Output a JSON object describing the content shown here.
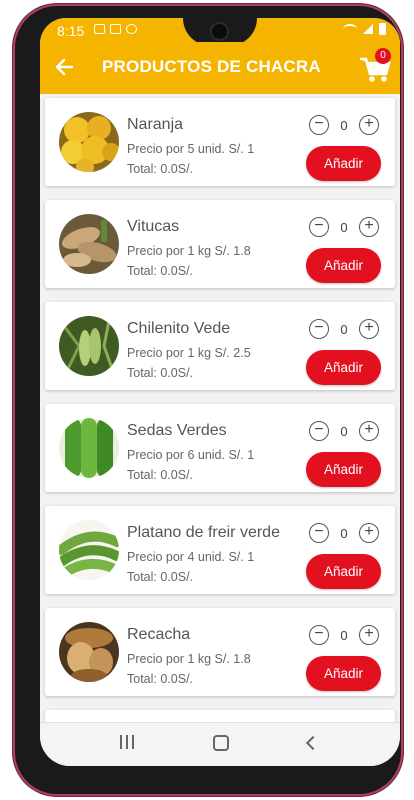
{
  "status_bar": {
    "time": "8:15"
  },
  "app_bar": {
    "title": "PRODUCTOS DE CHACRA",
    "cart_count": "0"
  },
  "products": [
    {
      "name": "Naranja",
      "price": "Precio por 5 unid. S/.  1",
      "total": "Total: 0.0S/.",
      "qty": "0",
      "add_label": "Añadir",
      "image": "orange"
    },
    {
      "name": "Vitucas",
      "price": "Precio por 1 kg S/.  1.8",
      "total": "Total: 0.0S/.",
      "qty": "0",
      "add_label": "Añadir",
      "image": "roots"
    },
    {
      "name": "Chilenito Vede",
      "price": "Precio por 1 kg S/.  2.5",
      "total": "Total: 0.0S/.",
      "qty": "0",
      "add_label": "Añadir",
      "image": "pods"
    },
    {
      "name": "Sedas Verdes",
      "price": "Precio por 6 unid. S/.  1",
      "total": "Total: 0.0S/.",
      "qty": "0",
      "add_label": "Añadir",
      "image": "zucchini"
    },
    {
      "name": "Platano de freir verde",
      "price": "Precio por 4 unid. S/.  1",
      "total": "Total: 0.0S/.",
      "qty": "0",
      "add_label": "Añadir",
      "image": "plantain"
    },
    {
      "name": "Recacha",
      "price": "Precio por 1 kg S/.  1.8",
      "total": "Total: 0.0S/.",
      "qty": "0",
      "add_label": "Añadir",
      "image": "tuber"
    }
  ],
  "colors": {
    "accent": "#f5b400",
    "button": "#e3101f"
  }
}
